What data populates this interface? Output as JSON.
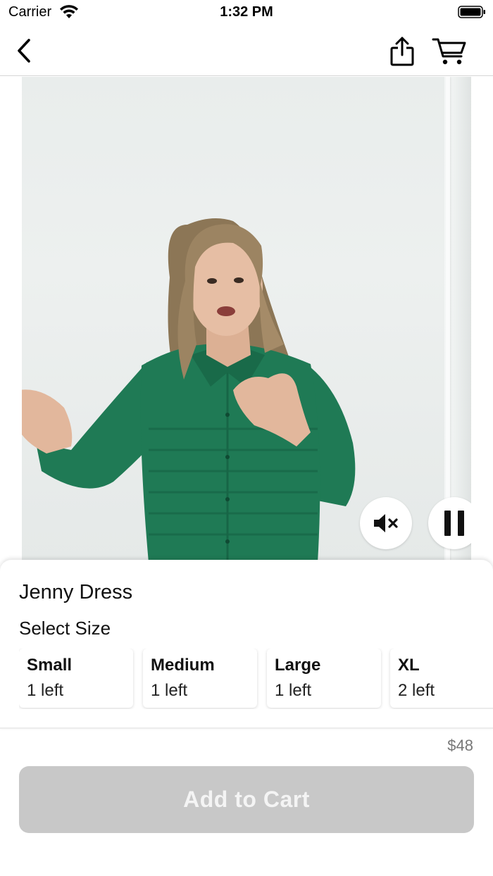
{
  "status_bar": {
    "carrier": "Carrier",
    "time": "1:32 PM"
  },
  "nav": {
    "back_icon": "chevron-left-icon",
    "share_icon": "share-icon",
    "cart_icon": "cart-icon"
  },
  "video": {
    "mute_icon": "speaker-muted-icon",
    "pause_icon": "pause-icon"
  },
  "product": {
    "title": "Jenny Dress",
    "select_size_label": "Select Size",
    "sizes": [
      {
        "name": "Small",
        "stock": "1 left"
      },
      {
        "name": "Medium",
        "stock": "1 left"
      },
      {
        "name": "Large",
        "stock": "1 left"
      },
      {
        "name": "XL",
        "stock": "2 left"
      }
    ],
    "price": "$48",
    "add_to_cart_label": "Add to Cart"
  },
  "colors": {
    "button_disabled": "#c8c8c8",
    "shirt_green": "#1f7a55"
  }
}
